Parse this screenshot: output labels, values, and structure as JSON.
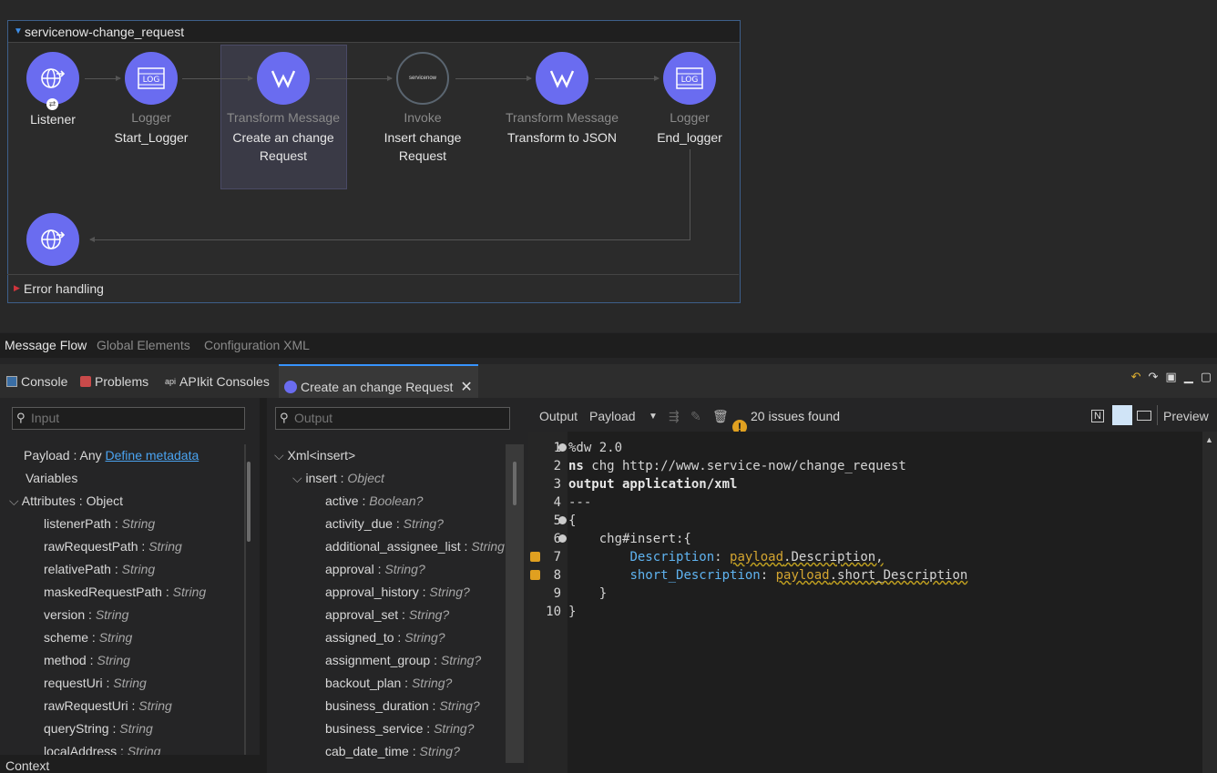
{
  "flow": {
    "name": "servicenow-change_request",
    "nodes": [
      {
        "type": "",
        "label": "Listener",
        "icon": "http-listener-icon"
      },
      {
        "type": "Logger",
        "label": "Start_Logger",
        "icon": "log-icon"
      },
      {
        "type": "Transform Message",
        "label": "Create an change Request",
        "icon": "transform-icon"
      },
      {
        "type": "Invoke",
        "label": "Insert change Request",
        "icon": "servicenow-icon"
      },
      {
        "type": "Transform Message",
        "label": "Transform to JSON",
        "icon": "transform-icon"
      },
      {
        "type": "Logger",
        "label": "End_logger",
        "icon": "log-icon"
      }
    ],
    "error_handling": "Error handling",
    "servicenow_logo_text": "servicenow"
  },
  "editor_tabs": [
    "Message Flow",
    "Global Elements",
    "Configuration XML"
  ],
  "view_tabs": [
    "Console",
    "Problems",
    "APIkit Consoles",
    "Create an change Request"
  ],
  "input": {
    "placeholder": "Input",
    "payload_label": "Payload : Any",
    "define_metadata": "Define metadata",
    "variables": "Variables",
    "attributes": {
      "name": "Attributes",
      "type": "Object"
    },
    "fields": [
      {
        "name": "listenerPath",
        "type": "String"
      },
      {
        "name": "rawRequestPath",
        "type": "String"
      },
      {
        "name": "relativePath",
        "type": "String"
      },
      {
        "name": "maskedRequestPath",
        "type": "String"
      },
      {
        "name": "version",
        "type": "String"
      },
      {
        "name": "scheme",
        "type": "String"
      },
      {
        "name": "method",
        "type": "String"
      },
      {
        "name": "requestUri",
        "type": "String"
      },
      {
        "name": "rawRequestUri",
        "type": "String"
      },
      {
        "name": "queryString",
        "type": "String"
      },
      {
        "name": "localAddress",
        "type": "String"
      }
    ],
    "context": "Context"
  },
  "output": {
    "placeholder": "Output",
    "root": "Xml<insert>",
    "insert": {
      "name": "insert",
      "type": "Object"
    },
    "fields": [
      {
        "name": "active",
        "type": "Boolean?"
      },
      {
        "name": "activity_due",
        "type": "String?"
      },
      {
        "name": "additional_assignee_list",
        "type": "String?"
      },
      {
        "name": "approval",
        "type": "String?"
      },
      {
        "name": "approval_history",
        "type": "String?"
      },
      {
        "name": "approval_set",
        "type": "String?"
      },
      {
        "name": "assigned_to",
        "type": "String?"
      },
      {
        "name": "assignment_group",
        "type": "String?"
      },
      {
        "name": "backout_plan",
        "type": "String?"
      },
      {
        "name": "business_duration",
        "type": "String?"
      },
      {
        "name": "business_service",
        "type": "String?"
      },
      {
        "name": "cab_date_time",
        "type": "String?"
      }
    ]
  },
  "script": {
    "output_label": "Output",
    "target": "Payload",
    "issues": "20 issues found",
    "preview": "Preview",
    "lines": [
      {
        "n": "1",
        "text": "%dw 2.0"
      },
      {
        "n": "2",
        "kw": "ns",
        "text": " chg http://www.service-now/change_request"
      },
      {
        "n": "3",
        "kw": "output application/xml",
        "text": ""
      },
      {
        "n": "4",
        "text": "---"
      },
      {
        "n": "5",
        "text": "{"
      },
      {
        "n": "6",
        "text": "    chg#insert:{"
      },
      {
        "n": "7",
        "field": "Description",
        "mid": ": ",
        "pl": "payload",
        "rest": ".Description,"
      },
      {
        "n": "8",
        "field": "short_Description",
        "mid": ": ",
        "pl": "payload",
        "rest": ".short_Description"
      },
      {
        "n": "9",
        "text": "    }"
      },
      {
        "n": "10",
        "text": "}"
      }
    ]
  }
}
